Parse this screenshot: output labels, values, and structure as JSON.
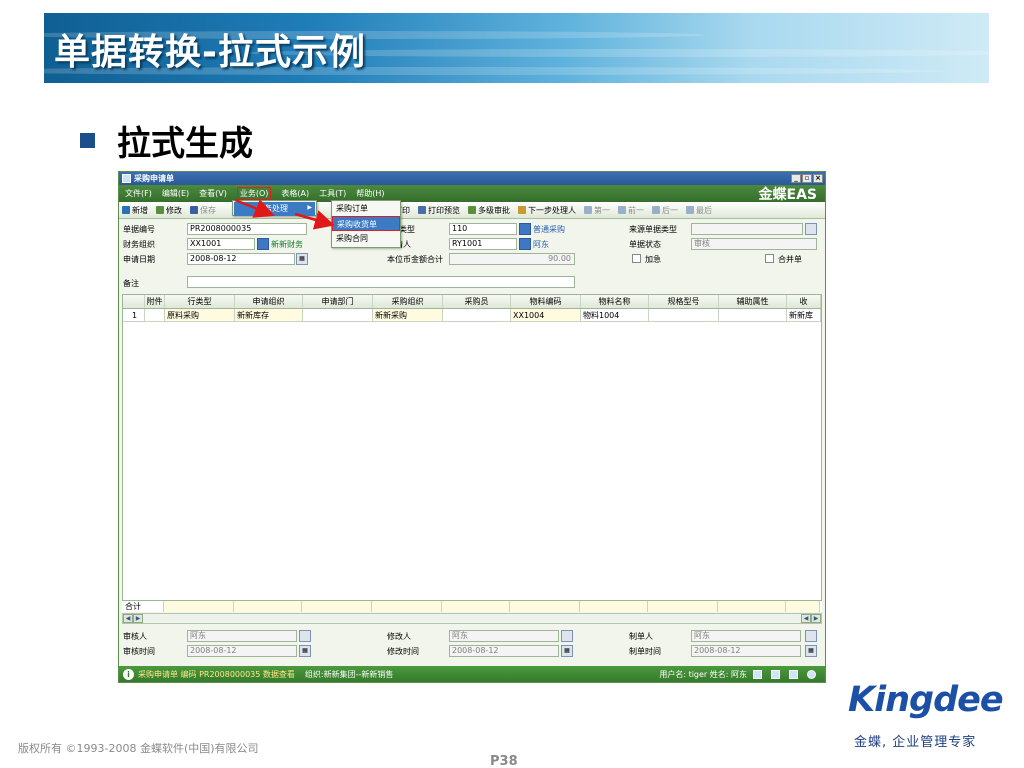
{
  "slide": {
    "title": "单据转换-拉式示例",
    "bullet": "拉式生成",
    "copyright": "版权所有 ©1993-2008 金蝶软件(中国)有限公司",
    "page_number": "P38",
    "logo_text": "Kingdee",
    "slogan": "金蝶, 企业管理专家"
  },
  "window": {
    "title": "采购申请单",
    "brand": "金蝶EAS"
  },
  "menubar": [
    {
      "label": "文件(F)"
    },
    {
      "label": "编辑(E)"
    },
    {
      "label": "查看(V)"
    },
    {
      "label": "业务(O)"
    },
    {
      "label": "表格(A)"
    },
    {
      "label": "工具(T)"
    },
    {
      "label": "帮助(H)"
    }
  ],
  "toolbar": [
    {
      "label": "新增",
      "color": "#2a6fb8"
    },
    {
      "label": "修改",
      "color": "#5a8f3c"
    },
    {
      "label": "保存",
      "color": "#3a5fa0"
    },
    {
      "label": "打印",
      "color": "#4a6fa8"
    },
    {
      "label": "打印预览",
      "color": "#4a6fa8"
    },
    {
      "label": "多级审批",
      "color": "#5a8f3c"
    },
    {
      "label": "下一步处理人",
      "color": "#c89a30"
    },
    {
      "label": "第一",
      "color": "#9ab0c8"
    },
    {
      "label": "前一",
      "color": "#9ab0c8"
    },
    {
      "label": "后一",
      "color": "#9ab0c8"
    },
    {
      "label": "最后",
      "color": "#9ab0c8"
    }
  ],
  "menus": {
    "business": {
      "item": "业务处理"
    },
    "submenu": [
      {
        "label": "采购订单"
      },
      {
        "label": "采购收货单"
      },
      {
        "label": "采购合同"
      }
    ]
  },
  "form": {
    "bill_no_label": "单据编号",
    "bill_no": "PR2008000035",
    "finance_org_label": "财务组织",
    "finance_org": "XX1001",
    "finance_org_name": "新新财务",
    "apply_date_label": "申请日期",
    "apply_date": "2008-08-12",
    "remark_label": "备注",
    "biz_type_label": "类型",
    "biz_type": "110",
    "biz_type_name": "普通采购",
    "applicant_label": "申请人",
    "applicant": "RY1001",
    "applicant_name": "阿东",
    "amount_label": "本位币金额合计",
    "amount": "90.00",
    "source_type_label": "来源单据类型",
    "status_label": "单据状态",
    "status": "审核",
    "urgent_label": "加急",
    "merge_label": "合并单"
  },
  "grid": {
    "columns": [
      "",
      "附件",
      "行类型",
      "申请组织",
      "申请部门",
      "采购组织",
      "采购员",
      "物料编码",
      "物料名称",
      "规格型号",
      "辅助属性",
      "收"
    ],
    "rows": [
      [
        "1",
        "",
        "原料采购",
        "新新库存",
        "",
        "新新采购",
        "",
        "XX1004",
        "物料1004",
        "",
        "",
        "新新库"
      ]
    ],
    "total_label": "合计"
  },
  "footer": {
    "auditor_label": "审核人",
    "auditor": "阿东",
    "audit_time_label": "审核时间",
    "audit_time": "2008-08-12",
    "modifier_label": "修改人",
    "modifier": "阿东",
    "modify_time_label": "修改时间",
    "modify_time": "2008-08-12",
    "creator_label": "制单人",
    "creator": "阿东",
    "create_time_label": "制单时间",
    "create_time": "2008-08-12"
  },
  "statusbar": {
    "message": "采购申请单 编码 PR2008000035 数据查看",
    "org": "组织:新新集团--新新销售",
    "user": "用户名: tiger  姓名: 阿东"
  }
}
